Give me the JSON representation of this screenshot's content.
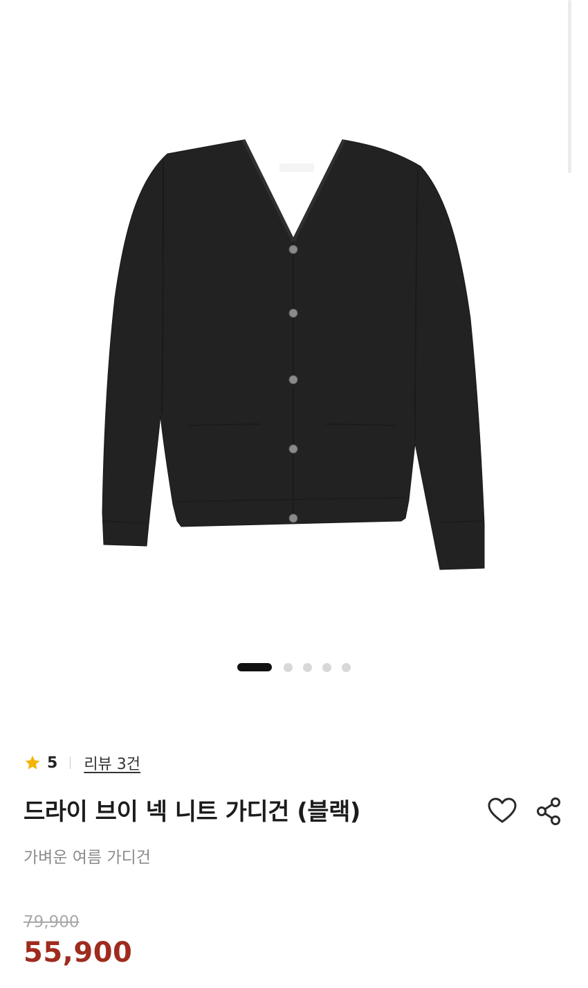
{
  "product": {
    "image_alt": "드라이 브이 넥 니트 가디건 (블랙)",
    "garment_color": "#222222",
    "carousel": {
      "total": 5,
      "active_index": 0
    },
    "rating": {
      "icon": "star-icon",
      "icon_color": "#f5b400",
      "value": "5"
    },
    "review_link": "리뷰 3건",
    "title": "드라이 브이 넥 니트 가디건 (블랙)",
    "subtitle": "가벼운 여름 가디건",
    "price": {
      "original": "79,900",
      "sale": "55,900",
      "sale_color": "#9e2b1e"
    },
    "actions": {
      "wishlist_icon": "heart-icon",
      "share_icon": "share-icon"
    }
  }
}
